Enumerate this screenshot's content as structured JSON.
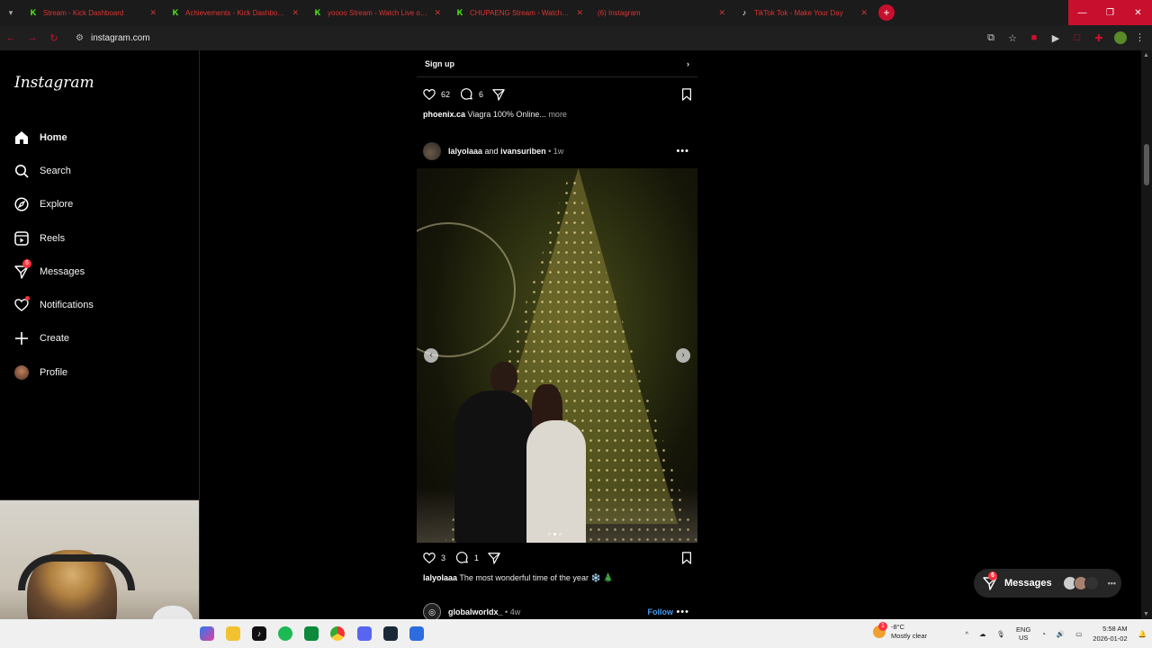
{
  "browser": {
    "tabs": [
      {
        "favicon": "kick",
        "title": "Stream - Kick Dashboard"
      },
      {
        "favicon": "kick",
        "title": "Achievements - Kick Dashboard"
      },
      {
        "favicon": "kick",
        "title": "yoooo Stream - Watch Live on Kick"
      },
      {
        "favicon": "kick",
        "title": "CHUPAENG Stream - Watch Live on Kick"
      },
      {
        "favicon": "instagram",
        "title": "(6) Instagram"
      },
      {
        "favicon": "tiktok",
        "title": "TikTok Tok - Make Your Day"
      }
    ],
    "url": "instagram.com"
  },
  "sidebar": {
    "logo": "Instagram",
    "items": [
      {
        "label": "Home",
        "icon": "home-icon",
        "active": true
      },
      {
        "label": "Search",
        "icon": "search-icon"
      },
      {
        "label": "Explore",
        "icon": "explore-icon"
      },
      {
        "label": "Reels",
        "icon": "reels-icon"
      },
      {
        "label": "Messages",
        "icon": "messages-icon",
        "badge": "6"
      },
      {
        "label": "Notifications",
        "icon": "heart-icon",
        "dot": true
      },
      {
        "label": "Create",
        "icon": "plus-icon"
      },
      {
        "label": "Profile",
        "icon": "avatar"
      }
    ]
  },
  "feed": {
    "prev_post": {
      "signup_label": "Sign up",
      "likes": "62",
      "comments": "6",
      "caption_user": "phoenix.ca",
      "caption_text": "Viagra 100% Online...",
      "more_label": "more"
    },
    "post": {
      "user1": "lalyolaaa",
      "and_label": "and",
      "user2": "ivansuriben",
      "time": "1w",
      "likes": "3",
      "comments": "1",
      "caption_user": "lalyolaaa",
      "caption_text": "The most wonderful time of the year ❄️ 🎄"
    },
    "next_post": {
      "user": "globalworldx_",
      "time": "4w",
      "follow_label": "Follow"
    }
  },
  "messages_pill": {
    "label": "Messages",
    "badge": "6"
  },
  "taskbar": {
    "weather_temp": "-8°C",
    "weather_desc": "Mostly clear",
    "weather_badge": "1",
    "lang_top": "ENG",
    "lang_bottom": "US",
    "time": "5:58 AM",
    "date": "2026-01-02"
  },
  "colors": {
    "accent_red": "#c8102e",
    "instagram_badge": "#ff3040",
    "follow_blue": "#4a9bf0",
    "kick_green": "#53fc18"
  }
}
